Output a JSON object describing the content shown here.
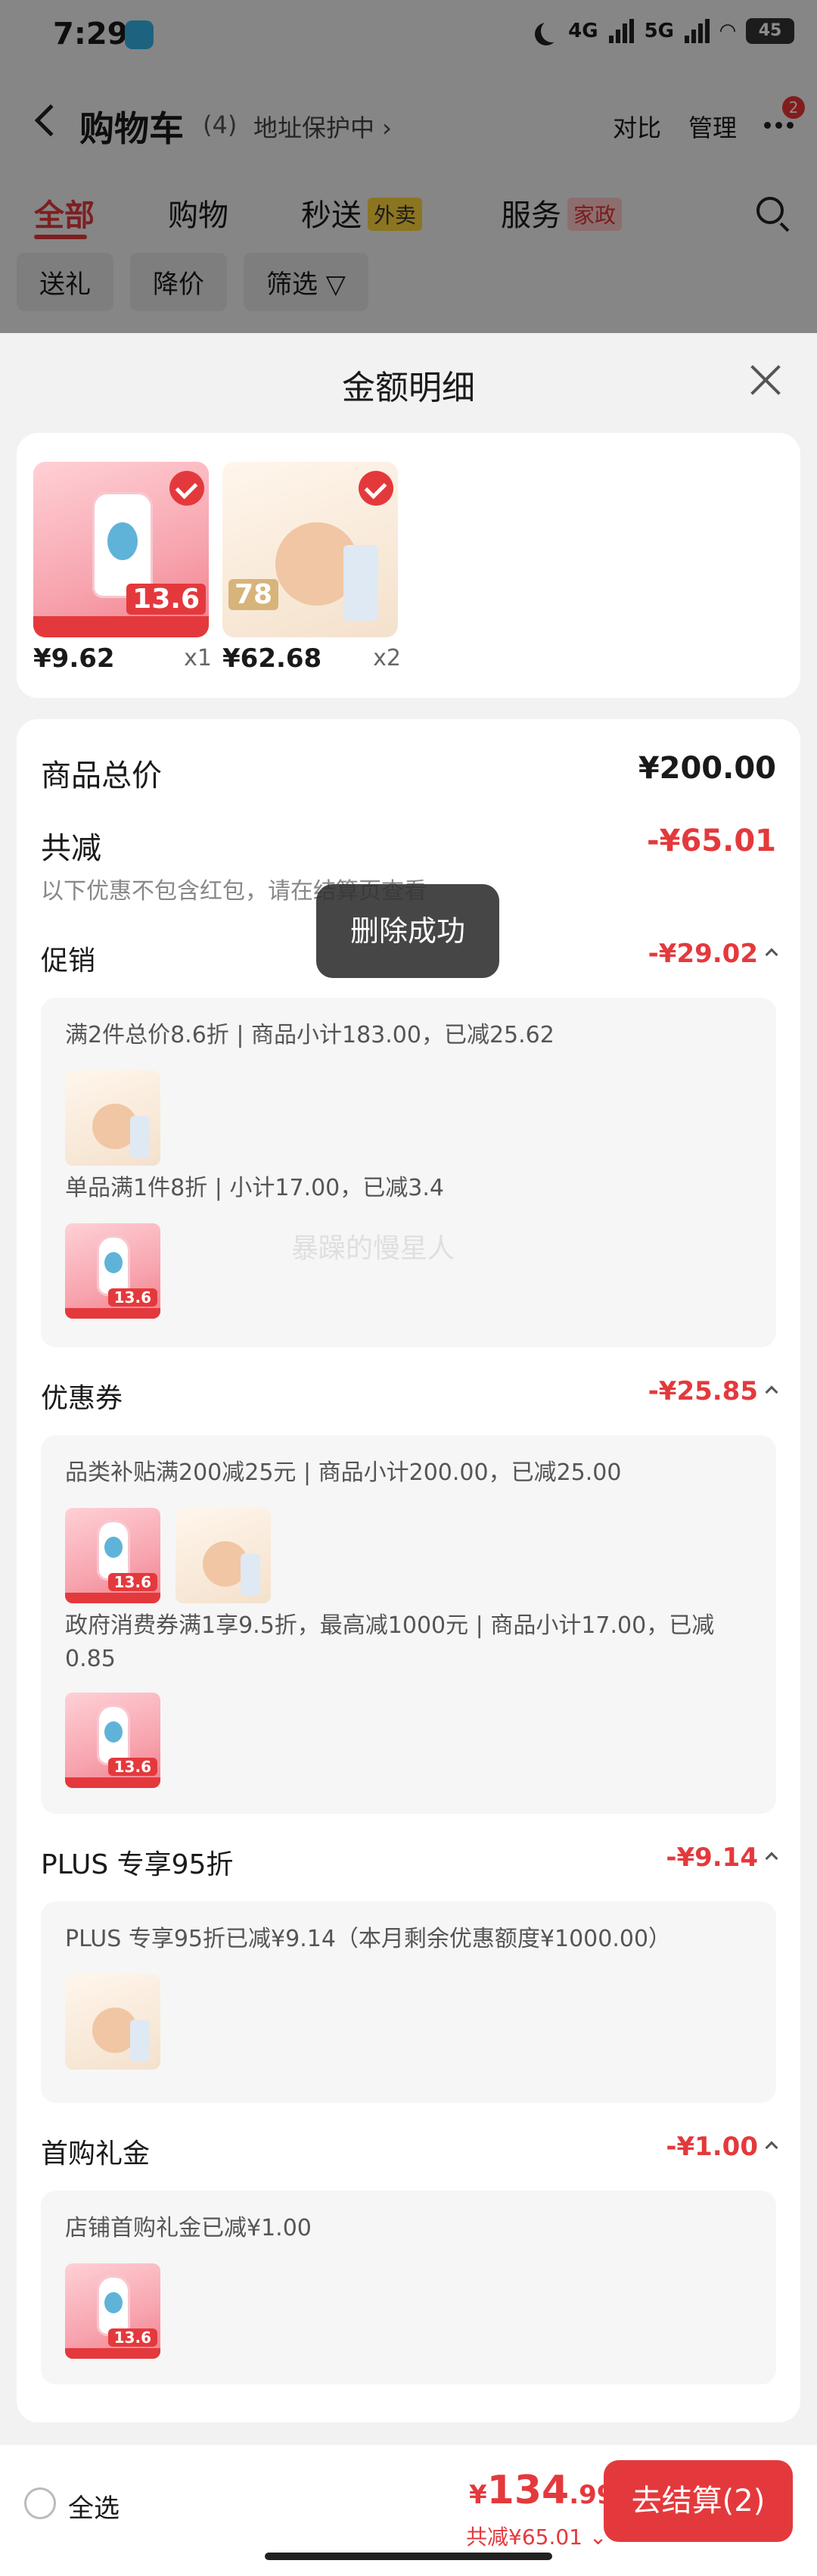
{
  "status": {
    "time": "7:29",
    "battery": "45",
    "net1": "4G",
    "net2": "5G"
  },
  "header": {
    "title": "购物车",
    "count": "(4)",
    "address": "地址保护中 ›",
    "compare": "对比",
    "manage": "管理",
    "badge": "2"
  },
  "tabs": [
    {
      "label": "全部"
    },
    {
      "label": "购物"
    },
    {
      "label": "秒送",
      "tag": "外卖"
    },
    {
      "label": "服务",
      "tag": "家政"
    }
  ],
  "chips": [
    "送礼",
    "降价",
    "筛选 ▽"
  ],
  "sheet": {
    "title": "金额明细",
    "products": [
      {
        "price": "¥9.62",
        "qty": "x1",
        "tag": "13.6"
      },
      {
        "price": "¥62.68",
        "qty": "x2",
        "tag": "78"
      }
    ],
    "total_label": "商品总价",
    "total_value": "¥200.00",
    "reduce_label": "共减",
    "reduce_value": "-¥65.01",
    "reduce_note": "以下优惠不包含红包，请在结算页查看",
    "sections": [
      {
        "label": "促销",
        "value": "-¥29.02",
        "lines": [
          "满2件总价8.6折 | 商品小计183.00，已减25.62",
          "单品满1件8折 | 小计17.00，已减3.4"
        ]
      },
      {
        "label": "优惠券",
        "value": "-¥25.85",
        "lines": [
          "品类补贴满200减25元 | 商品小计200.00，已减25.00",
          "政府消费券满1享9.5折，最高减1000元 | 商品小计17.00，已减0.85"
        ]
      },
      {
        "label": "PLUS 专享95折",
        "value": "-¥9.14",
        "lines": [
          "PLUS 专享95折已减¥9.14（本月剩余优惠额度¥1000.00）"
        ]
      },
      {
        "label": "首购礼金",
        "value": "-¥1.00",
        "lines": [
          "店铺首购礼金已减¥1.00"
        ]
      }
    ]
  },
  "toast": "删除成功",
  "watermark": "暴躁的慢星人",
  "bottom": {
    "select_all": "全选",
    "currency": "¥",
    "total_int": "134",
    "total_dec": ".99",
    "saved": "共减¥65.01 ⌄",
    "checkout": "去结算(2)"
  }
}
